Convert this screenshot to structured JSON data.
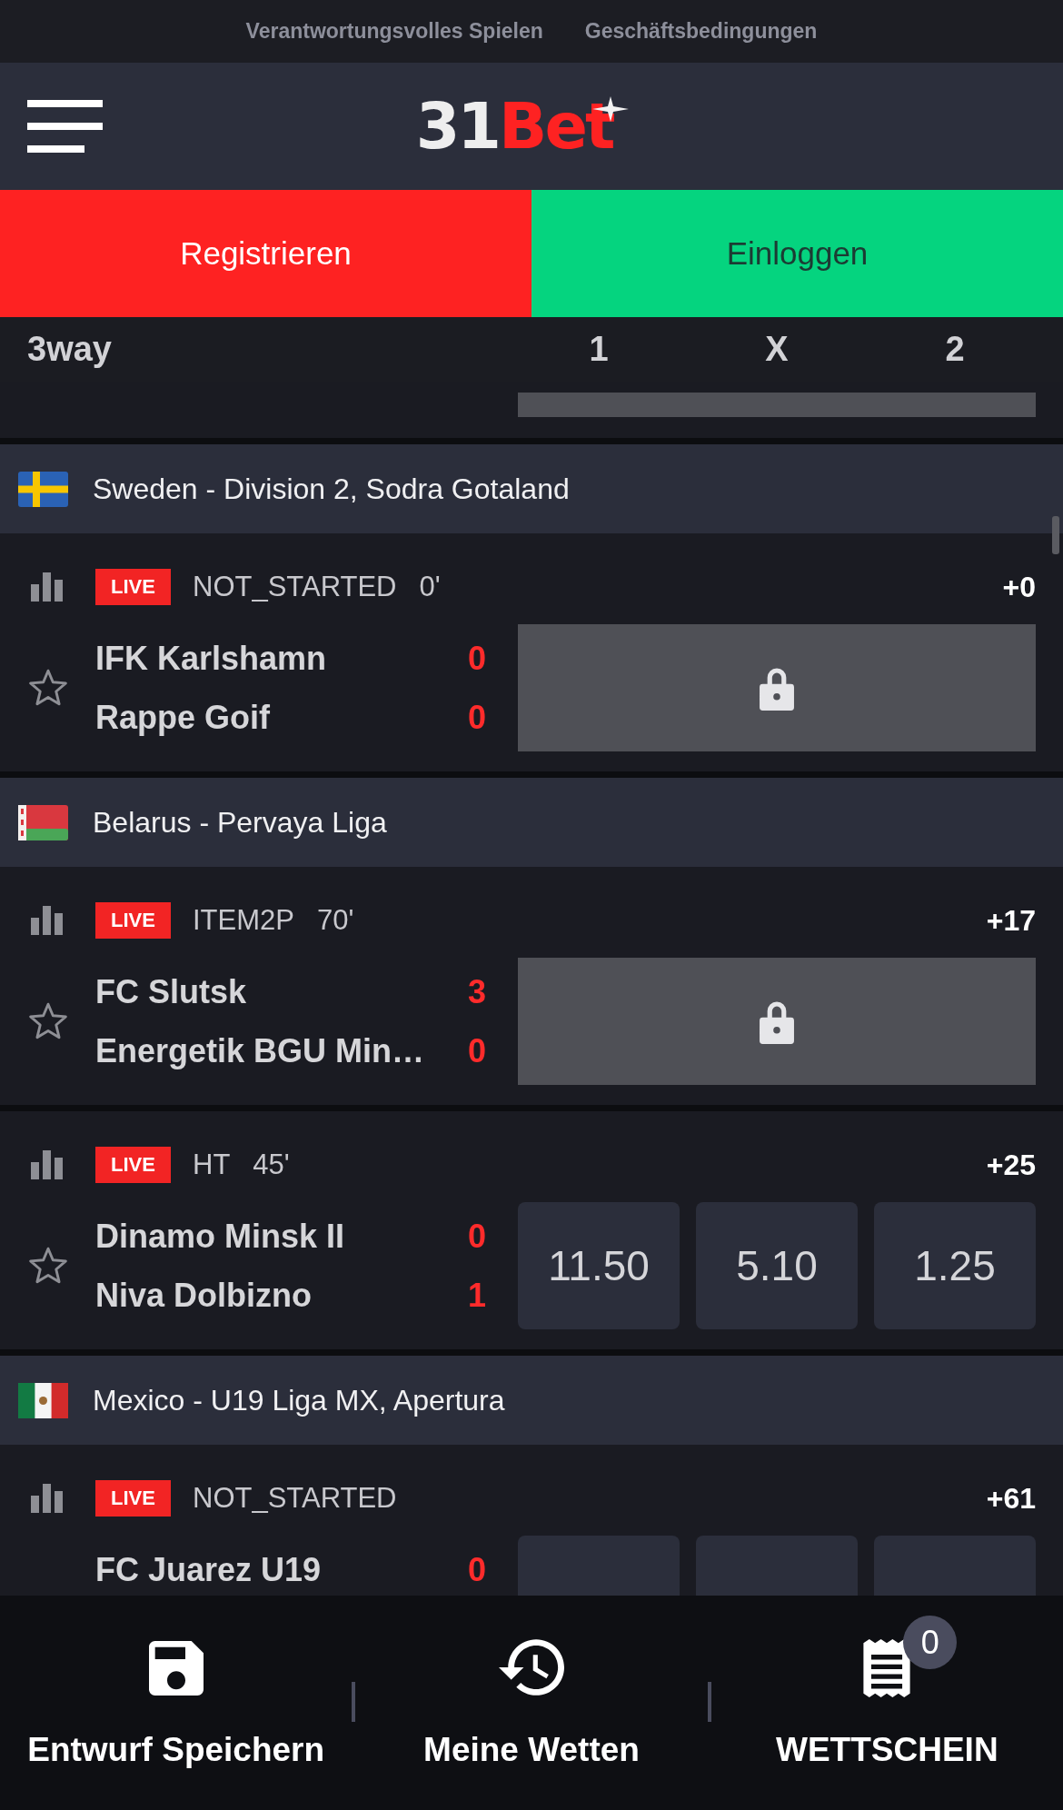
{
  "top_links": [
    {
      "label": "Verantwortungsvolles Spielen"
    },
    {
      "label": "Geschäftsbedingungen"
    }
  ],
  "header": {
    "logo": [
      {
        "text": "31",
        "color": "#eeeeee"
      },
      {
        "text": "Bet",
        "color": "#fe2222"
      }
    ]
  },
  "auth_buttons": [
    {
      "kind": "register",
      "label": "Registrieren"
    },
    {
      "kind": "login",
      "label": "Einloggen"
    }
  ],
  "market_header": {
    "market": "3way",
    "columns": [
      "1",
      "X",
      "2"
    ]
  },
  "previous_match_tail": {
    "locked": true
  },
  "leagues": [
    {
      "flag": {
        "kind": "sweden"
      },
      "name": "Sweden - Division 2, Sodra Gotaland",
      "matches": [
        {
          "live_label": "LIVE",
          "status": "NOT_STARTED",
          "minute": "0'",
          "more_markets": "+0",
          "favorite": false,
          "teams": [
            {
              "name": "IFK Karlshamn",
              "score": "0"
            },
            {
              "name": "Rappe Goif",
              "score": "0"
            }
          ],
          "locked": true
        }
      ]
    },
    {
      "flag": {
        "kind": "belarus"
      },
      "name": "Belarus - Pervaya Liga",
      "matches": [
        {
          "live_label": "LIVE",
          "status": "ITEM2P",
          "minute": "70'",
          "more_markets": "+17",
          "favorite": false,
          "teams": [
            {
              "name": "FC Slutsk",
              "score": "3"
            },
            {
              "name": "Energetik BGU Min…",
              "score": "0"
            }
          ],
          "locked": true
        },
        {
          "live_label": "LIVE",
          "status": "HT",
          "minute": "45'",
          "more_markets": "+25",
          "favorite": false,
          "teams": [
            {
              "name": "Dinamo Minsk II",
              "score": "0"
            },
            {
              "name": "Niva Dolbizno",
              "score": "1"
            }
          ],
          "locked": false,
          "odds": [
            "11.50",
            "5.10",
            "1.25"
          ]
        }
      ]
    },
    {
      "flag": {
        "kind": "mexico"
      },
      "name": "Mexico - U19 Liga MX, Apertura",
      "matches": [
        {
          "live_label": "LIVE",
          "status": "NOT_STARTED",
          "more_markets": "+61",
          "teams": [
            {
              "name": "FC Juarez U19",
              "score": "0"
            }
          ],
          "locked": false
        }
      ]
    }
  ],
  "bottom_nav": [
    {
      "kind": "save",
      "label": "Entwurf Speichern"
    },
    {
      "kind": "history",
      "label": "Meine Wetten"
    },
    {
      "kind": "betslip",
      "label": "WETTSCHEIN",
      "badge": "0"
    }
  ]
}
